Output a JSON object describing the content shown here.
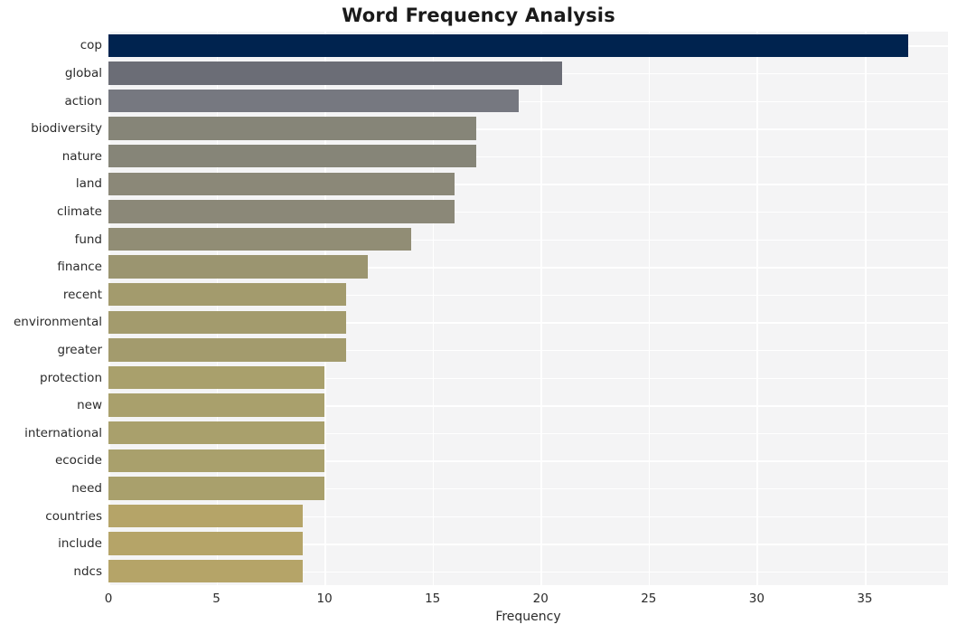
{
  "chart_data": {
    "type": "bar",
    "orientation": "horizontal",
    "title": "Word Frequency Analysis",
    "xlabel": "Frequency",
    "ylabel": "",
    "categories": [
      "cop",
      "global",
      "action",
      "biodiversity",
      "nature",
      "land",
      "climate",
      "fund",
      "finance",
      "recent",
      "environmental",
      "greater",
      "protection",
      "new",
      "international",
      "ecocide",
      "need",
      "countries",
      "include",
      "ndcs"
    ],
    "values": [
      37,
      21,
      19,
      17,
      17,
      16,
      16,
      14,
      12,
      11,
      11,
      11,
      10,
      10,
      10,
      10,
      10,
      9,
      9,
      9
    ],
    "bar_colors": [
      "#00234f",
      "#6b6d76",
      "#767880",
      "#868578",
      "#868578",
      "#8b8878",
      "#8b8878",
      "#918d75",
      "#9b9570",
      "#a39b6d",
      "#a39b6d",
      "#a39b6d",
      "#a9a06c",
      "#a9a06c",
      "#a9a06c",
      "#a9a06c",
      "#a9a06c",
      "#b5a468",
      "#b5a468",
      "#b5a468"
    ],
    "xlim": [
      0,
      38.85
    ],
    "xticks": [
      0,
      5,
      10,
      15,
      20,
      25,
      30,
      35
    ],
    "xtick_labels": [
      "0",
      "5",
      "10",
      "15",
      "20",
      "25",
      "30",
      "35"
    ],
    "grid": true,
    "grid_axis": "both",
    "legend": null,
    "style": {
      "plot_background": "#f4f4f5",
      "figure_background": "#ffffff",
      "grid_color": "#ffffff",
      "text_color": "#2b2b2b",
      "title_color": "#1a1a1a"
    }
  }
}
